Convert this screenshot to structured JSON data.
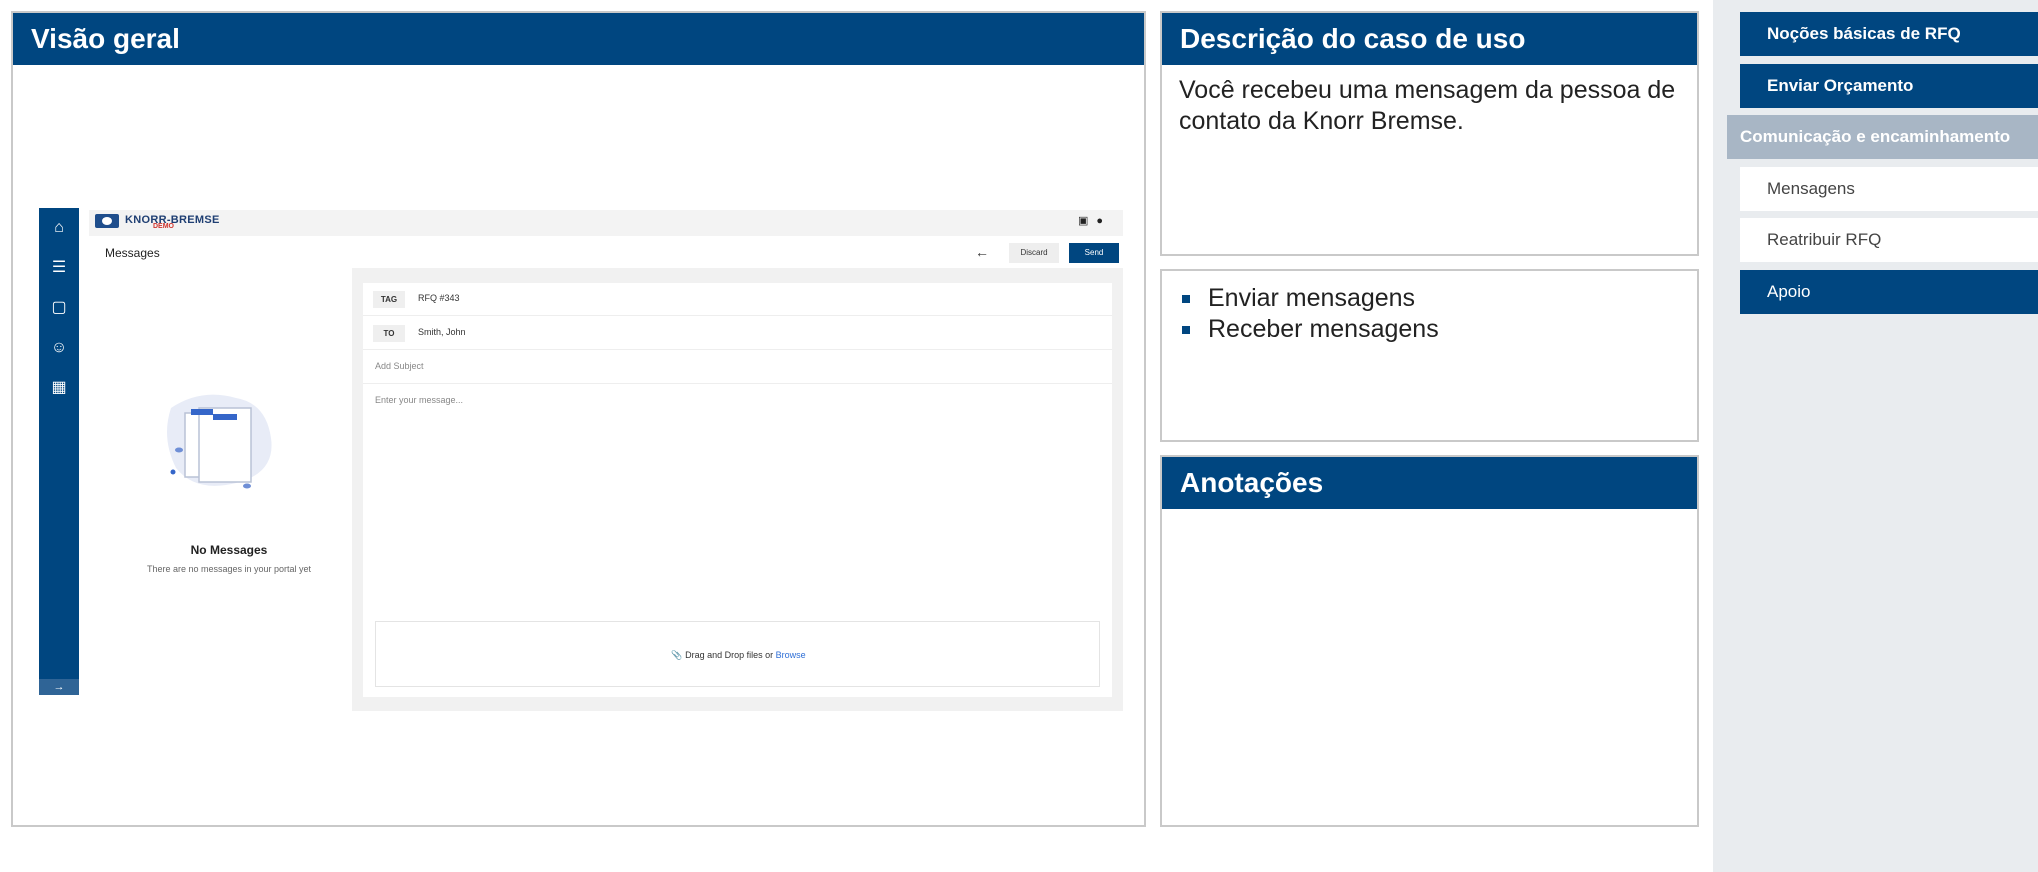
{
  "overview": {
    "title": "Visão geral"
  },
  "usecase": {
    "title": "Descrição do caso de uso",
    "text": "Você recebeu uma mensagem da pessoa de contato da Knorr Bremse."
  },
  "features": {
    "items": [
      "Enviar mensagens",
      "Receber mensagens"
    ]
  },
  "notes": {
    "title": "Anotações"
  },
  "nav": {
    "items": [
      {
        "label": "Noções básicas de RFQ"
      },
      {
        "label": "Enviar Orçamento"
      },
      {
        "label": "Comunicação e encaminhamento"
      },
      {
        "label": "Mensagens"
      },
      {
        "label": "Reatribuir RFQ"
      },
      {
        "label": "Apoio"
      }
    ]
  },
  "app": {
    "logo_text": "KNORR-BREMSE",
    "logo_badge": "DEMO",
    "page_title": "Messages",
    "discard_label": "Discard",
    "send_label": "Send",
    "tag_label": "TAG",
    "tag_value": "RFQ #343",
    "to_label": "TO",
    "to_value": "Smith, John",
    "subject_placeholder": "Add Subject",
    "message_placeholder": "Enter your message...",
    "drop_text": "Drag and Drop files or",
    "browse_label": "Browse",
    "empty_title": "No Messages",
    "empty_subtitle": "There are no messages in your portal yet",
    "icons": [
      "home-icon",
      "database-icon",
      "documents-icon",
      "supplier-icon",
      "truck-icon",
      "chat-icon",
      "user-icon",
      "back-arrow-icon",
      "paperclip-icon",
      "expand-icon"
    ]
  },
  "colors": {
    "brand": "#004680",
    "nav_active": "#a8b6c5",
    "nav_bg": "#e9ecef",
    "link": "#2f6fd6"
  }
}
